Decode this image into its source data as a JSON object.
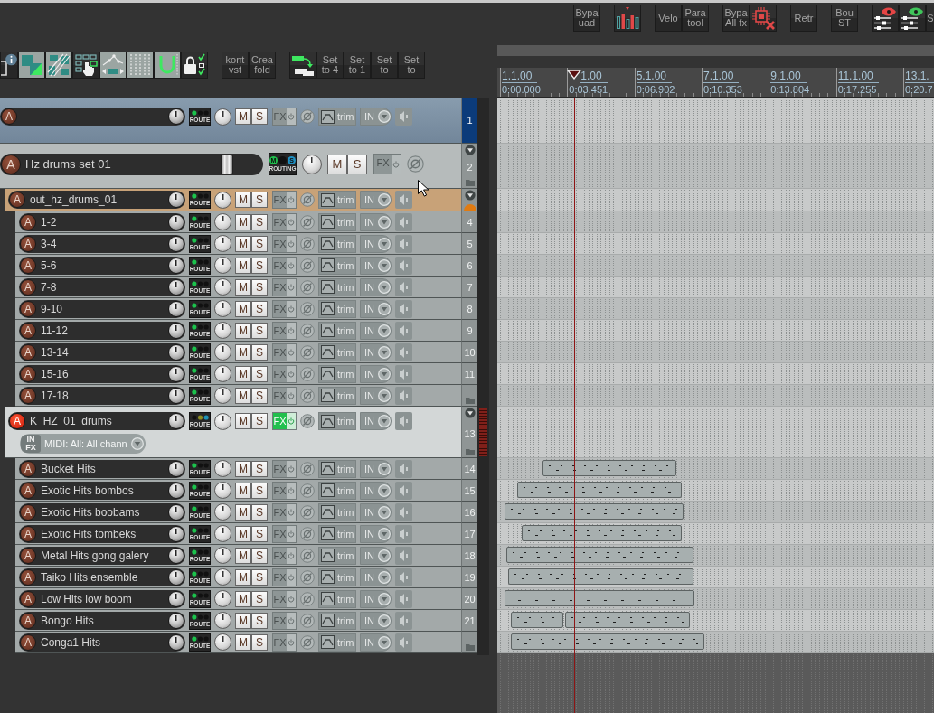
{
  "top_toolbar": {
    "groups": [
      [
        {
          "kind": "text",
          "lines": [
            "Bypa",
            "uad"
          ]
        }
      ],
      [
        {
          "kind": "icon"
        }
      ],
      [
        {
          "kind": "text",
          "lines": [
            "Velo"
          ]
        },
        {
          "kind": "text",
          "lines": [
            "Para",
            "tool"
          ]
        }
      ],
      [
        {
          "kind": "text",
          "lines": [
            "Bypa",
            "All fx"
          ]
        },
        {
          "kind": "icon"
        }
      ],
      [
        {
          "kind": "text",
          "lines": [
            "Retr"
          ]
        }
      ],
      [
        {
          "kind": "text",
          "lines": [
            "Bou",
            "ST"
          ]
        }
      ],
      [
        {
          "kind": "icon"
        },
        {
          "kind": "icon"
        },
        {
          "kind": "text",
          "lines": [
            "S"
          ]
        }
      ]
    ]
  },
  "edit_toolbar": {
    "groups": [
      [
        {
          "kind": "icon",
          "on": false
        },
        {
          "kind": "icon",
          "on": true
        },
        {
          "kind": "icon",
          "on": true
        },
        {
          "kind": "icon",
          "on": false
        },
        {
          "kind": "icon",
          "on": true
        },
        {
          "kind": "icon",
          "on": true
        },
        {
          "kind": "icon",
          "on": true
        },
        {
          "kind": "icon",
          "on": false
        }
      ],
      [
        {
          "kind": "text",
          "lines": [
            "kont",
            "vst"
          ]
        },
        {
          "kind": "text",
          "lines": [
            "Crea",
            "fold"
          ]
        }
      ],
      [
        {
          "kind": "icon"
        },
        {
          "kind": "text",
          "lines": [
            "Set",
            "to 4"
          ]
        },
        {
          "kind": "text",
          "lines": [
            "Set",
            "to 1"
          ]
        },
        {
          "kind": "text",
          "lines": [
            "Set",
            "to"
          ]
        },
        {
          "kind": "text",
          "lines": [
            "Set",
            "to"
          ]
        }
      ]
    ]
  },
  "ruler": {
    "marks": [
      {
        "bar": "1.1.00",
        "time": "0:00.000"
      },
      {
        "bar": "1.00",
        "time": "0:03.451"
      },
      {
        "bar": "5.1.00",
        "time": "0:06.902"
      },
      {
        "bar": "7.1.00",
        "time": "0:10.353"
      },
      {
        "bar": "9.1.00",
        "time": "0:13.804"
      },
      {
        "bar": "11.1.00",
        "time": "0:17.255"
      },
      {
        "bar": "13.1.",
        "time": "0:20.7"
      }
    ]
  },
  "tracks": [
    {
      "kind": "audio",
      "number": "1",
      "selected": true,
      "arm": "A",
      "armed": false,
      "route": "ROUTE",
      "mute": "M",
      "muted": false,
      "solo": "S",
      "soloed": false,
      "fx": "FX",
      "fx_on": false,
      "trim": "trim",
      "input": "IN"
    },
    {
      "kind": "bus",
      "number": "2",
      "expanded": true,
      "folder_icon": true,
      "selected": false,
      "arm": "A",
      "armed": false,
      "name": "Hz drums set 01",
      "level": 0.71,
      "route": "ROUTING",
      "route_badges": [
        "M",
        "S"
      ],
      "mute": "M",
      "muted": false,
      "solo": "S",
      "soloed": false,
      "fx": "FX",
      "fx_on": false,
      "children": [
        {
          "kind": "audio",
          "expanded": true,
          "color": "#e07b12",
          "selected": false,
          "arm": "A",
          "armed": false,
          "name": "out_hz_drums_01",
          "route": "ROUTE",
          "mute": "M",
          "muted": false,
          "solo": "S",
          "soloed": false,
          "fx": "FX",
          "fx_on": false,
          "trim": "trim",
          "input": "IN",
          "children": [
            {
              "kind": "audio",
              "number": "4",
              "selected": false,
              "arm": "A",
              "armed": false,
              "name": "1-2",
              "route": "ROUTE",
              "mute": "M",
              "muted": false,
              "solo": "S",
              "soloed": false,
              "fx": "FX",
              "fx_on": false,
              "trim": "trim",
              "input": "IN"
            },
            {
              "kind": "audio",
              "number": "5",
              "selected": false,
              "arm": "A",
              "armed": false,
              "name": "3-4",
              "route": "ROUTE",
              "mute": "M",
              "muted": false,
              "solo": "S",
              "soloed": false,
              "fx": "FX",
              "fx_on": false,
              "trim": "trim",
              "input": "IN"
            },
            {
              "kind": "audio",
              "number": "6",
              "selected": false,
              "arm": "A",
              "armed": false,
              "name": "5-6",
              "route": "ROUTE",
              "mute": "M",
              "muted": false,
              "solo": "S",
              "soloed": false,
              "fx": "FX",
              "fx_on": false,
              "trim": "trim",
              "input": "IN"
            },
            {
              "kind": "audio",
              "number": "7",
              "selected": false,
              "arm": "A",
              "armed": false,
              "name": "7-8",
              "route": "ROUTE",
              "mute": "M",
              "muted": false,
              "solo": "S",
              "soloed": false,
              "fx": "FX",
              "fx_on": false,
              "trim": "trim",
              "input": "IN"
            },
            {
              "kind": "audio",
              "number": "8",
              "selected": false,
              "arm": "A",
              "armed": false,
              "name": "9-10",
              "route": "ROUTE",
              "mute": "M",
              "muted": false,
              "solo": "S",
              "soloed": false,
              "fx": "FX",
              "fx_on": false,
              "trim": "trim",
              "input": "IN"
            },
            {
              "kind": "audio",
              "number": "9",
              "selected": false,
              "arm": "A",
              "armed": false,
              "name": "11-12",
              "route": "ROUTE",
              "mute": "M",
              "muted": false,
              "solo": "S",
              "soloed": false,
              "fx": "FX",
              "fx_on": false,
              "trim": "trim",
              "input": "IN"
            },
            {
              "kind": "audio",
              "number": "10",
              "selected": false,
              "arm": "A",
              "armed": false,
              "name": "13-14",
              "route": "ROUTE",
              "mute": "M",
              "muted": false,
              "solo": "S",
              "soloed": false,
              "fx": "FX",
              "fx_on": false,
              "trim": "trim",
              "input": "IN"
            },
            {
              "kind": "audio",
              "number": "11",
              "selected": false,
              "arm": "A",
              "armed": false,
              "name": "15-16",
              "route": "ROUTE",
              "mute": "M",
              "muted": false,
              "solo": "S",
              "soloed": false,
              "fx": "FX",
              "fx_on": false,
              "trim": "trim",
              "input": "IN"
            },
            {
              "kind": "audio",
              "folder_icon": true,
              "selected": false,
              "arm": "A",
              "armed": false,
              "name": "17-18",
              "route": "ROUTE",
              "mute": "M",
              "muted": false,
              "solo": "S",
              "soloed": false,
              "fx": "FX",
              "fx_on": false,
              "trim": "trim",
              "input": "IN"
            }
          ]
        },
        {
          "kind": "midi",
          "number": "13",
          "expanded": true,
          "folder_icon": true,
          "selected": false,
          "arm": "A",
          "armed": true,
          "name": "K_HZ_01_drums",
          "route": "ROUTE",
          "mute": "M",
          "muted": false,
          "solo": "S",
          "soloed": false,
          "fx": "FX",
          "fx_on": true,
          "trim": "trim",
          "input": "IN",
          "input_fx": [
            "IN",
            "FX"
          ],
          "midi_input": "MIDI: All: All chann",
          "children": [
            {
              "kind": "audio",
              "number": "14",
              "selected": false,
              "arm": "A",
              "armed": false,
              "name": "Bucket Hits",
              "route": "ROUTE",
              "mute": "M",
              "muted": false,
              "solo": "S",
              "soloed": false,
              "fx": "FX",
              "fx_on": false,
              "trim": "trim",
              "input": "IN"
            },
            {
              "kind": "audio",
              "number": "15",
              "selected": false,
              "arm": "A",
              "armed": false,
              "name": "Exotic Hits bombos",
              "route": "ROUTE",
              "mute": "M",
              "muted": false,
              "solo": "S",
              "soloed": false,
              "fx": "FX",
              "fx_on": false,
              "trim": "trim",
              "input": "IN"
            },
            {
              "kind": "audio",
              "number": "16",
              "selected": false,
              "arm": "A",
              "armed": false,
              "name": "Exotic Hits boobams",
              "route": "ROUTE",
              "mute": "M",
              "muted": false,
              "solo": "S",
              "soloed": false,
              "fx": "FX",
              "fx_on": false,
              "trim": "trim",
              "input": "IN"
            },
            {
              "kind": "audio",
              "number": "17",
              "selected": false,
              "arm": "A",
              "armed": false,
              "name": "Exotic Hits tombeks",
              "route": "ROUTE",
              "mute": "M",
              "muted": false,
              "solo": "S",
              "soloed": false,
              "fx": "FX",
              "fx_on": false,
              "trim": "trim",
              "input": "IN"
            },
            {
              "kind": "audio",
              "number": "18",
              "selected": false,
              "arm": "A",
              "armed": false,
              "name": "Metal Hits gong galery",
              "route": "ROUTE",
              "mute": "M",
              "muted": false,
              "solo": "S",
              "soloed": false,
              "fx": "FX",
              "fx_on": false,
              "trim": "trim",
              "input": "IN"
            },
            {
              "kind": "audio",
              "number": "19",
              "selected": false,
              "arm": "A",
              "armed": false,
              "name": "Taiko Hits ensemble",
              "route": "ROUTE",
              "mute": "M",
              "muted": false,
              "solo": "S",
              "soloed": false,
              "fx": "FX",
              "fx_on": false,
              "trim": "trim",
              "input": "IN"
            },
            {
              "kind": "audio",
              "number": "20",
              "selected": false,
              "arm": "A",
              "armed": false,
              "name": "Low Hits low boom",
              "route": "ROUTE",
              "mute": "M",
              "muted": false,
              "solo": "S",
              "soloed": false,
              "fx": "FX",
              "fx_on": false,
              "trim": "trim",
              "input": "IN"
            },
            {
              "kind": "audio",
              "number": "21",
              "selected": false,
              "arm": "A",
              "armed": false,
              "name": "Bongo Hits",
              "route": "ROUTE",
              "mute": "M",
              "muted": false,
              "solo": "S",
              "soloed": false,
              "fx": "FX",
              "fx_on": false,
              "trim": "trim",
              "input": "IN"
            },
            {
              "kind": "audio",
              "folder_icon": true,
              "selected": false,
              "arm": "A",
              "armed": false,
              "name": "Conga1 Hits",
              "route": "ROUTE",
              "mute": "M",
              "muted": false,
              "solo": "S",
              "soloed": false,
              "fx": "FX",
              "fx_on": false,
              "trim": "trim",
              "input": "IN"
            }
          ]
        }
      ]
    }
  ]
}
